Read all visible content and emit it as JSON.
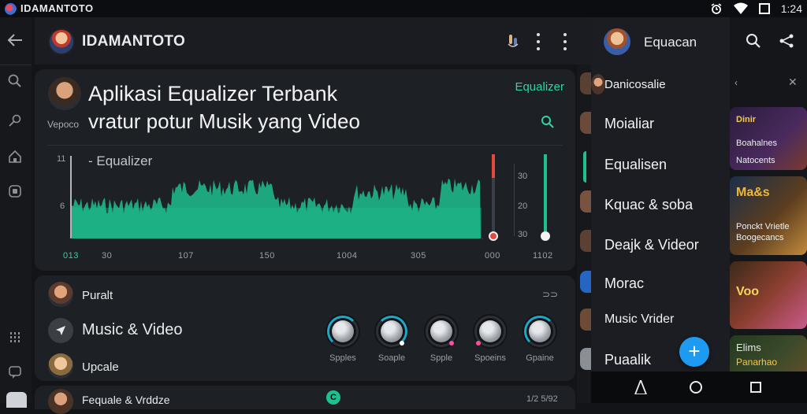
{
  "status_bar": {
    "app_name": "IDAMANTOTO",
    "time": "1:24"
  },
  "app_bar": {
    "title": "IDAMANTOTO"
  },
  "eq_card": {
    "title": "Aplikasi Equalizer Terbank",
    "subtitle": "vratur potur Musik yang Video",
    "small_label": "Vepoco",
    "badge": "Equalizer",
    "wave_label": "- Equalizer",
    "y_labels": [
      "11",
      "6"
    ],
    "x_labels": [
      "013",
      "30",
      "107",
      "150",
      "1004",
      "305",
      "000",
      "1102"
    ],
    "meter_labels": [
      "30",
      "20",
      "30"
    ],
    "colors": {
      "accent": "#2fd3a5",
      "wave": "#1fbf8f",
      "red": "#e24b3b"
    }
  },
  "card2": {
    "rows": [
      {
        "label": "Puralt"
      },
      {
        "label": "Music & Video"
      },
      {
        "label": "Upcale"
      }
    ],
    "corner_label": "⊃⊃",
    "knobs": [
      {
        "label": "Spples",
        "dot": "#ffffff"
      },
      {
        "label": "Soaple",
        "dot": "#ffffff"
      },
      {
        "label": "Spple",
        "dot": "#ff4fa0"
      },
      {
        "label": "Spoeins",
        "dot": "#ff4fa0"
      },
      {
        "label": "Gpaine",
        "dot": "#ffffff"
      }
    ]
  },
  "card3": {
    "label": "Fequale & Vrddze",
    "right": "1/2 5/92",
    "badge": "C"
  },
  "drawer": {
    "name": "Equacan",
    "items": [
      "Danicosalie",
      "Moialiar",
      "Equalisen",
      "Kquac & soba",
      "Deajk & Videor",
      "Morac",
      "Music Vrider",
      "Puaalik"
    ]
  },
  "right_tiles": [
    {
      "line1": "Dinir",
      "line2": "Boahalnes",
      "line3": "Natocents"
    },
    {
      "line1": "Ma&s",
      "line2": "Ponckt Vrietle",
      "line3": "Boogecancs"
    },
    {
      "line1": "Voo",
      "line2": ""
    },
    {
      "line1": "Elims",
      "line2": "Panarhao"
    }
  ]
}
